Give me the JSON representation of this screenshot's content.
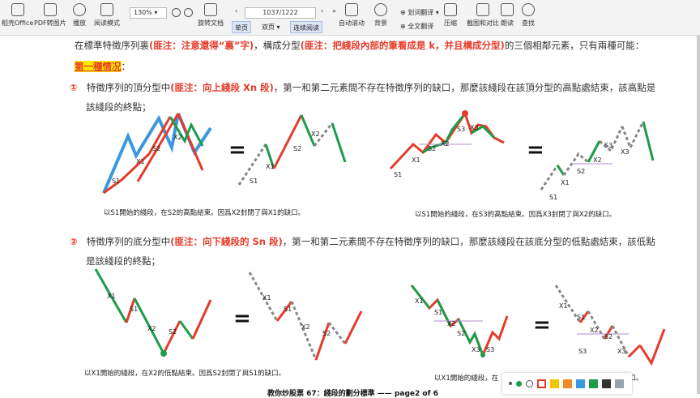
{
  "toolbar": {
    "office_label": "稻壳Office",
    "pdf2img_label": "PDF转图片",
    "play_label": "播放",
    "read_mode_label": "阅读模式",
    "zoom_value": "130%",
    "rotate_label": "旋转文档",
    "page_value": "1037/1222",
    "single_label": "单页",
    "double_label": "双页",
    "continuous_label": "连续阅读",
    "autoscroll_label": "自动滚动",
    "background_label": "背景",
    "translate_label": "划词翻译",
    "fulltrans_label": "全文翻译",
    "compress_label": "压缩",
    "screenshot_label": "截图和对比",
    "read_aloud_label": "朗读",
    "search_label": "查找"
  },
  "doc": {
    "line1_a": "在標準特徵序列裏",
    "line1_b": "(匪注：注意還得“裏”字)",
    "line1_c": "，構成分型",
    "line1_d": "(匪注：把綫段內部的筆看成是 k，并且構成分型)",
    "line1_e": "的三個相鄰元素，只有兩種可能：",
    "case1_heading": "第一種情况",
    "case1_colon": "：",
    "item1_num": "①",
    "item1_a": "特徵序列的頂分型中",
    "item1_b": "(匪注：向上綫段 Xn 段)",
    "item1_c": "，第一和第二元素間不存在特徵序列的缺口，那麼該綫段在該頂分型的高點處結束，該高點是",
    "item1_d": "該綫段的終點；",
    "cap1": "以S1開始的綫段，在S2的高點結束。因爲X2封閉了與X1的缺口。",
    "cap2": "以S1開始的綫段，在S3的高點結束。因爲X3封閉了與X2的缺口。",
    "item2_num": "②",
    "item2_a": "特徵序列的底分型中",
    "item2_b": "(匪注：向下綫段的 Sn 段)",
    "item2_c": "，第一和第二元素間不存在特徵序列的缺口，那麼該綫段在該底分型的低點處結束，該低點",
    "item2_d": "是該綫段的終點；",
    "cap3": "以X1開始的綫段，在X2的低點結束。因爲S2封閉了與S1的缺口。",
    "cap4": "以X1開始的綫段，在",
    "cap4_end": "缺口。",
    "footer": "教你炒股票 67：綫段的劃分標準 —— page2 of 6",
    "eq": "=",
    "labels": {
      "S1": "S1",
      "S2": "S2",
      "S3": "S3",
      "X1": "X1",
      "X2": "X2",
      "X3": "X3"
    }
  },
  "colors": {
    "red": "#e53b2a",
    "green": "#1e9b4a",
    "blue": "#3a97e0",
    "gray": "#888888",
    "purple": "#b58bd0"
  }
}
